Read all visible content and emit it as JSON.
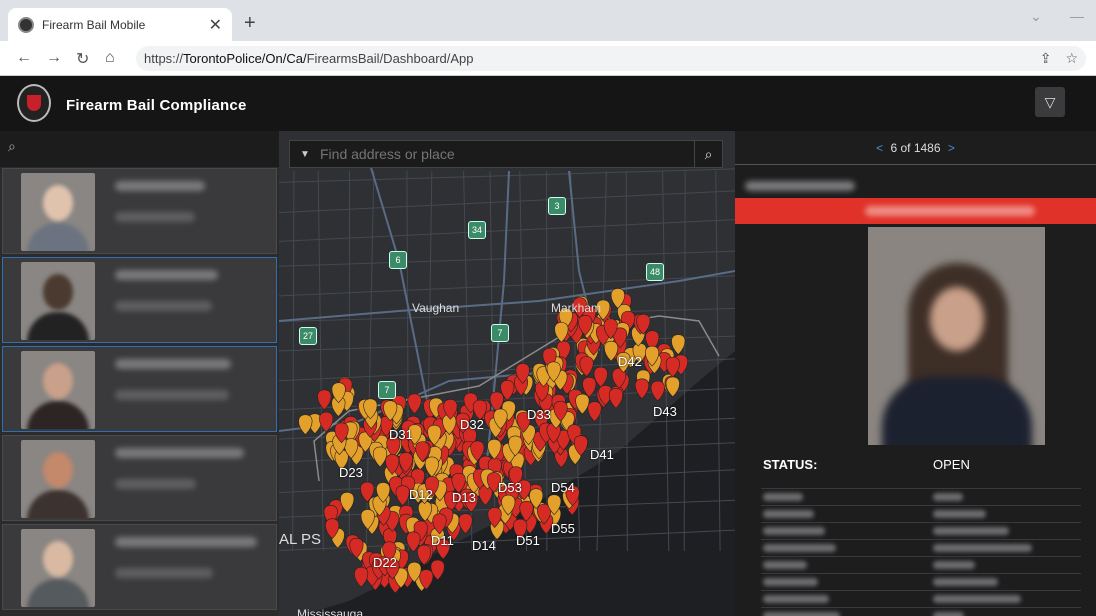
{
  "browser": {
    "tab_title": "Firearm Bail Mobile",
    "tab_close": "✕",
    "new_tab": "+",
    "url_prefix": "https://",
    "url_host": "TorontoPolice/On/Ca/",
    "url_path": "FirearmsBail/Dashboard/App",
    "icons": [
      "back-icon",
      "forward-icon",
      "reload-icon",
      "home-icon",
      "share-icon",
      "star-icon"
    ]
  },
  "app": {
    "title": "Firearm Bail Compliance",
    "filter_icon": "▽"
  },
  "left_list": {
    "search_icon": "⌕",
    "items": [
      {
        "photo_colors": [
          "#e0c3ad",
          "#6b7380"
        ],
        "selected": false
      },
      {
        "photo_colors": [
          "#4a3a30",
          "#222"
        ],
        "selected": true
      },
      {
        "photo_colors": [
          "#c9a08a",
          "#2d2424"
        ],
        "selected": true
      },
      {
        "photo_colors": [
          "#c4886a",
          "#3c3230"
        ],
        "selected": false
      },
      {
        "photo_colors": [
          "#d9b9a2",
          "#555a5e"
        ],
        "selected": false
      }
    ]
  },
  "map": {
    "search_placeholder": "Find address or place",
    "places": [
      {
        "name": "Vaughan"
      },
      {
        "name": "Markham"
      },
      {
        "name": "AL PS"
      },
      {
        "name": "Mississauga"
      }
    ],
    "highways": [
      "3",
      "34",
      "6",
      "48",
      "27",
      "7",
      "7"
    ],
    "divisions": [
      "D42",
      "D43",
      "D31",
      "D32",
      "D33",
      "D41",
      "D23",
      "D12",
      "D13",
      "D53",
      "D54",
      "D55",
      "D11",
      "D14",
      "D51",
      "D22"
    ],
    "marker_colors": {
      "red": "#d62a24",
      "orange": "#e3a02a"
    }
  },
  "detail": {
    "pager_prev": "<",
    "pager_text": "6 of 1486",
    "pager_next": ">",
    "status_label": "STATUS:",
    "status_value": "OPEN",
    "banner_color": "#e03228"
  }
}
